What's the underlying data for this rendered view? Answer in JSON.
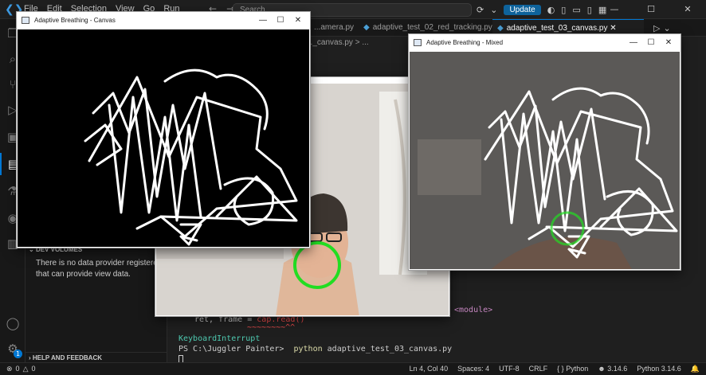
{
  "menu": [
    "File",
    "Edit",
    "Selection",
    "View",
    "Go",
    "Run"
  ],
  "search_placeholder": "Search",
  "update_label": "Update",
  "tabs": [
    {
      "label": "...amera.py"
    },
    {
      "label": "adaptive_test_02_red_tracking.py"
    },
    {
      "label": "adaptive_test_03_canvas.py"
    }
  ],
  "breadcrumb": "..._canvas.py > ...",
  "sidebar": {
    "dev_volumes_header": "DEV VOLUMES",
    "dev_volumes_message": "There is no data provider registered that can provide view data.",
    "help_header": "HELP AND FEEDBACK"
  },
  "terminal": {
    "module_tag": "<module>",
    "code_line": "ret, frame = cap.read()",
    "code_prefix": "ret, frame = ",
    "code_call": "cap.read()",
    "squiggle": "~~~~~~~~^^",
    "error": "KeyboardInterrupt",
    "prompt": "PS C:\\Juggler Painter>",
    "command_program": "python",
    "command_arg": "adaptive_test_03_canvas.py"
  },
  "windows": {
    "canvas_title": "Adaptive Breathing - Canvas",
    "mixed_title": "Adaptive Breathing - Mixed"
  },
  "statusbar": {
    "errors": "0",
    "warnings": "0",
    "position": "Ln 4, Col 40",
    "spaces": "Spaces: 4",
    "encoding": "UTF-8",
    "eol": "CRLF",
    "language": "Python",
    "version_short": "3.14.6",
    "interpreter": "Python 3.14.6"
  },
  "activity_badge": "1",
  "colors": {
    "accent": "#0078d4",
    "terminal_error": "#4ec9b0",
    "prompt_command": "#dcdcaa",
    "tracking_circle": "#22dd22"
  }
}
